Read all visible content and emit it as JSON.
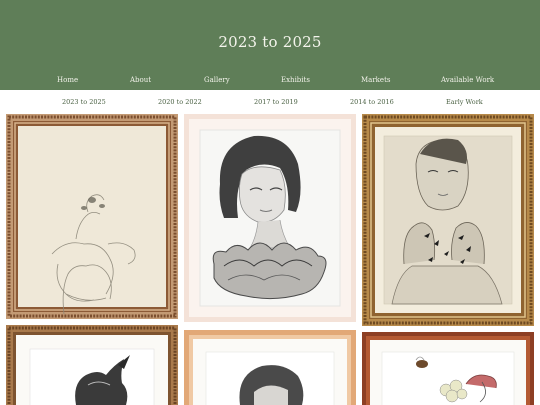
{
  "site": {
    "title": "2023 to 2025"
  },
  "main_nav": [
    {
      "label": "Home"
    },
    {
      "label": "About"
    },
    {
      "label": "Gallery"
    },
    {
      "label": "Exhibits"
    },
    {
      "label": "Markets"
    },
    {
      "label": "Available Work"
    }
  ],
  "sub_nav": [
    {
      "label": "2023 to 2025"
    },
    {
      "label": "2020 to 2022"
    },
    {
      "label": "2017 to 2019"
    },
    {
      "label": "2014 to 2016"
    },
    {
      "label": "Early Work"
    }
  ],
  "colors": {
    "header_bg": "#5f7e58",
    "header_text": "#f4f4ec",
    "subnav_text": "#4a6143"
  },
  "artworks": [
    {
      "icon": "figure-with-plant-sketch-icon"
    },
    {
      "icon": "woman-portrait-ruffle-sketch-icon"
    },
    {
      "icon": "woman-hands-birds-sketch-icon"
    },
    {
      "icon": "bird-head-sketch-icon"
    },
    {
      "icon": "portrait-sketch-icon"
    },
    {
      "icon": "bee-flower-bird-sketch-icon"
    }
  ]
}
